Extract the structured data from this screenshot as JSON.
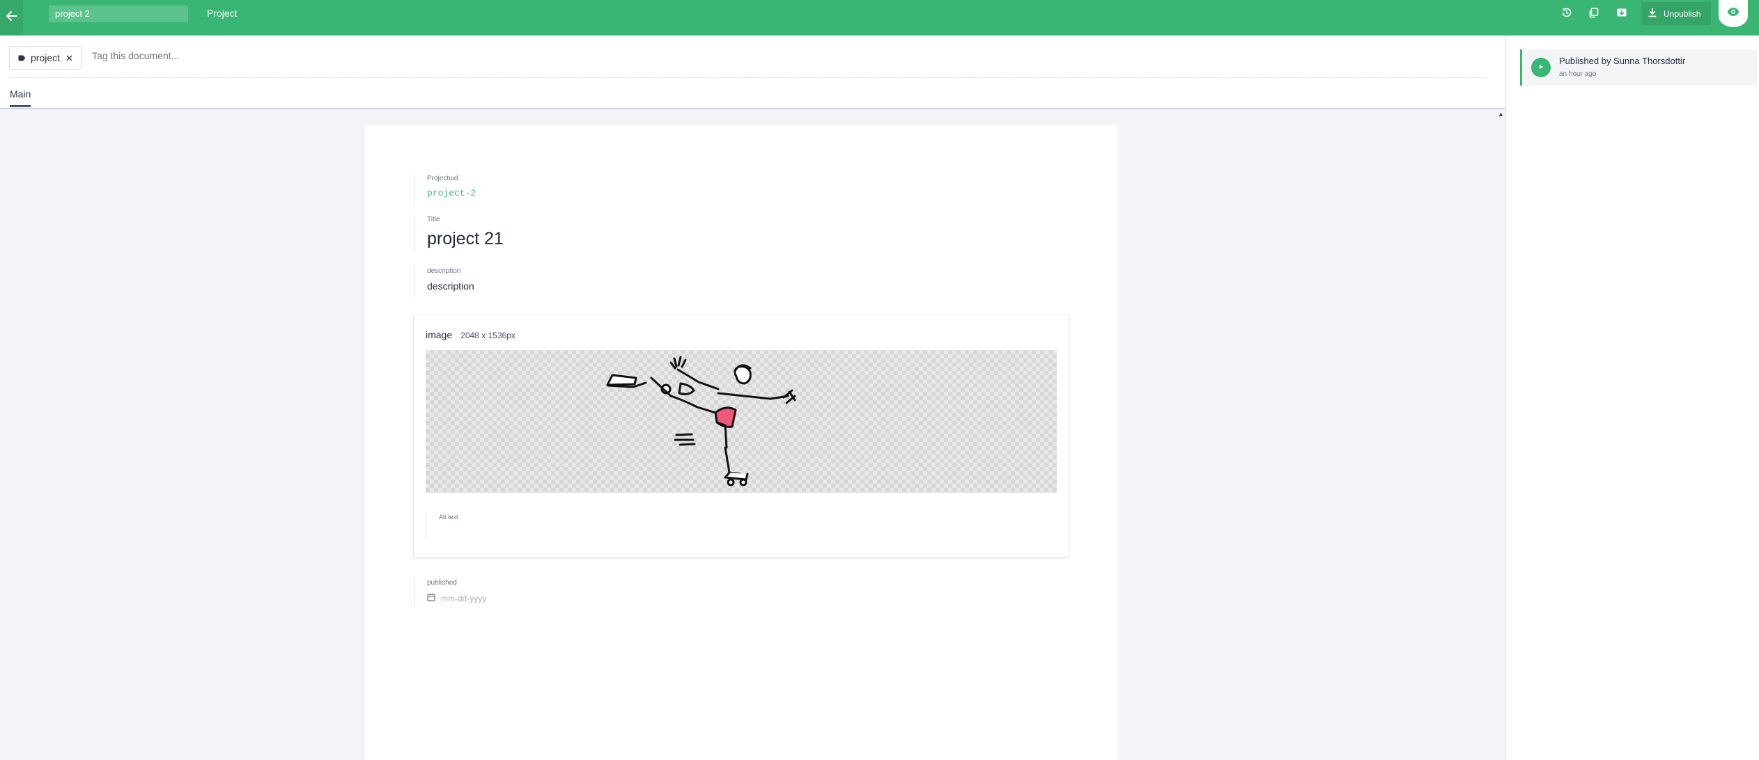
{
  "topbar": {
    "document_title": "project 2",
    "document_type": "Project",
    "unpublish_label": "Unpublish",
    "accent_color": "#3ab674"
  },
  "tags": {
    "items": [
      "project"
    ],
    "placeholder": "Tag this document..."
  },
  "tabs": [
    {
      "label": "Main",
      "active": true
    }
  ],
  "document": {
    "fields": {
      "projectuid": {
        "label": "Projectuid",
        "value": "project-2"
      },
      "title": {
        "label": "Title",
        "value": "project 21"
      },
      "description": {
        "label": "description",
        "value": "description"
      },
      "image": {
        "label": "image",
        "dimensions": "2048 x 1536px",
        "alt_label": "Alt text"
      },
      "published": {
        "label": "published",
        "placeholder": "mm-dd-yyyy"
      }
    }
  },
  "history": {
    "entries": [
      {
        "title": "Published by Sunna Thorsdottir",
        "time": "an hour ago"
      }
    ]
  }
}
